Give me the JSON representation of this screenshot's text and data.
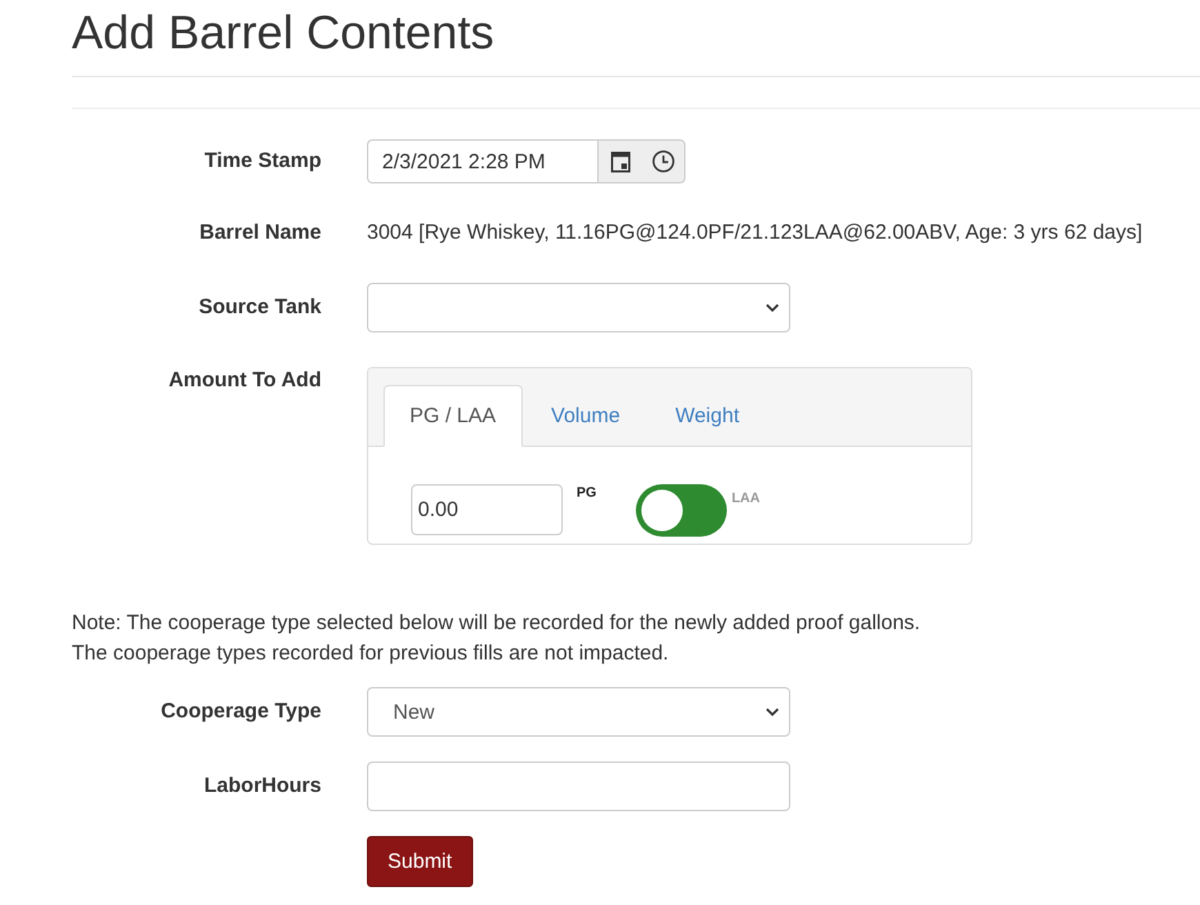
{
  "title": "Add Barrel Contents",
  "rows": [
    {
      "kind": "datetime",
      "label": "Time Stamp",
      "value": "2/3/2021 2:28 PM"
    },
    {
      "kind": "static",
      "label": "Barrel Name",
      "value": "3004 [Rye Whiskey, 11.16PG@124.0PF/21.123LAA@62.00ABV, Age: 3 yrs 62 days]"
    },
    {
      "kind": "select",
      "label": "Source Tank"
    },
    {
      "kind": "amount",
      "label": "Amount To Add",
      "tabs": [
        {
          "label": "PG / LAA",
          "selected": true
        },
        {
          "label": "Volume",
          "selected": false
        },
        {
          "label": "Weight",
          "selected": false
        }
      ],
      "value": "0.00",
      "toggle": {
        "left_label": "PG",
        "right_label": "LAA",
        "on": false
      }
    },
    {
      "kind": "note",
      "lines": [
        "Note: The cooperage type selected below will be recorded for the newly added proof gallons.",
        "The cooperage types recorded for previous fills are not impacted."
      ]
    },
    {
      "kind": "select",
      "label": "Cooperage Type",
      "value": "New"
    },
    {
      "kind": "input",
      "label": "LaborHours"
    },
    {
      "kind": "button",
      "label": "Submit"
    }
  ]
}
